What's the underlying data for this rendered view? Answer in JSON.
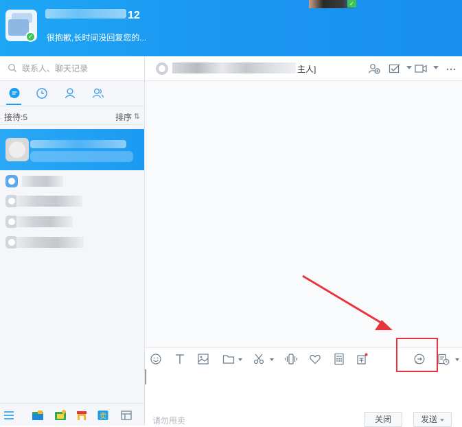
{
  "profile": {
    "name_suffix": "12",
    "signature": "很抱歉,长时间没回复您的..."
  },
  "search": {
    "placeholder": "联系人、聊天记录"
  },
  "left_tabs": [
    {
      "icon": "chat-icon",
      "active": true
    },
    {
      "icon": "clock-icon",
      "active": false
    },
    {
      "icon": "person-icon",
      "active": false
    },
    {
      "icon": "group-icon",
      "active": false
    }
  ],
  "reception": {
    "label": "接待:5",
    "sort_label": "排序",
    "sort_icon": "⇅"
  },
  "chat": {
    "title_suffix": "主人]"
  },
  "toolbar_icons": [
    "emoji-icon",
    "font-icon",
    "image-icon",
    "folder-icon",
    "scissors-icon",
    "vibrate-icon",
    "heart-icon",
    "calculator-icon",
    "gift-icon",
    "quick-reply-icon",
    "history-icon"
  ],
  "input": {
    "hint": "请勿甩卖"
  },
  "buttons": {
    "close": "关闭",
    "send": "发送"
  },
  "colors": {
    "accent": "#1a9cf2",
    "annotation": "#e8353b",
    "online": "#3cc45a"
  }
}
